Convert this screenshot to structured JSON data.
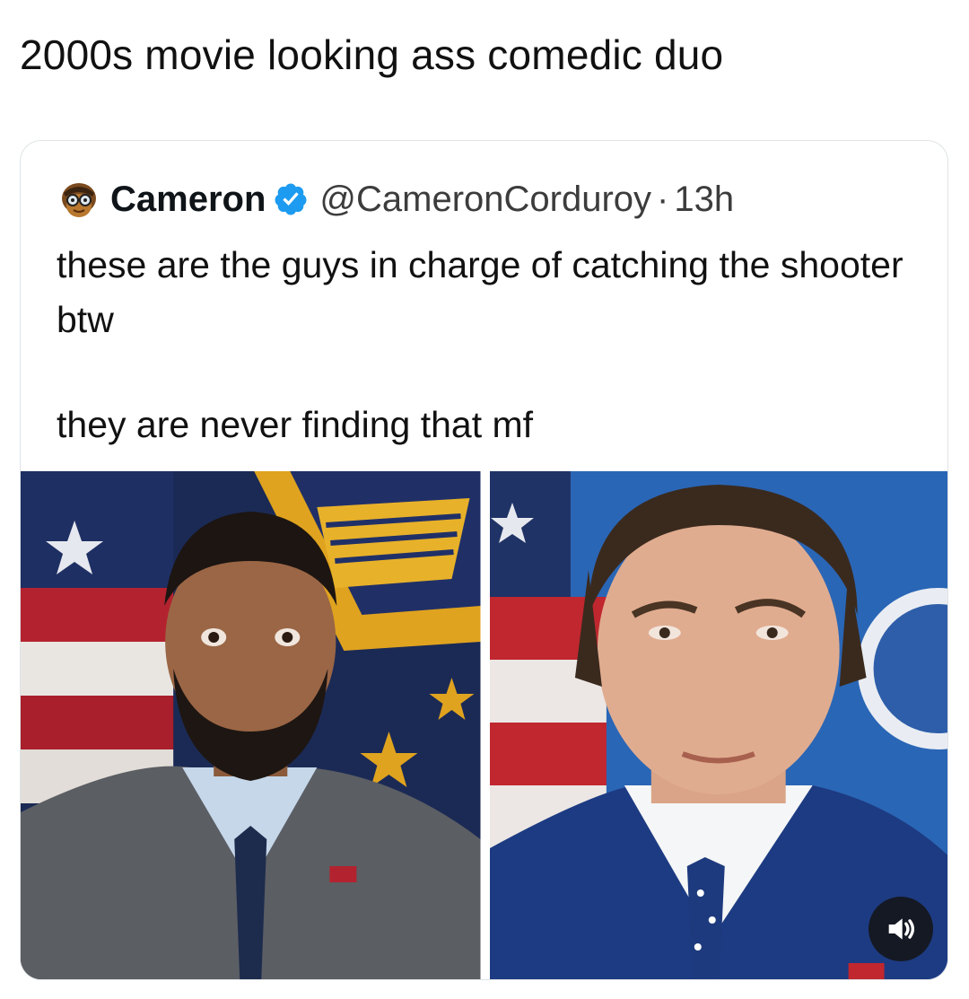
{
  "caption": "2000s movie looking ass comedic duo",
  "tweet": {
    "avatar_icon": "cartoon-avatar-with-glasses",
    "display_name": "Cameron",
    "verified_icon": "verified-badge-icon",
    "handle": "@CameronCorduroy",
    "separator": "·",
    "time": "13h",
    "text_line_1": "these are the guys in charge of catching the shooter btw",
    "text_line_2": "they are never finding that mf"
  },
  "media": {
    "photos": [
      {
        "subject": "man-in-gray-suit-portrait"
      },
      {
        "subject": "man-in-navy-suit-portrait"
      }
    ],
    "sound_icon": "speaker-volume-icon"
  },
  "colors": {
    "verified_blue": "#1d9bf0",
    "card_border": "#dfe3e6",
    "text": "#0f1419"
  }
}
